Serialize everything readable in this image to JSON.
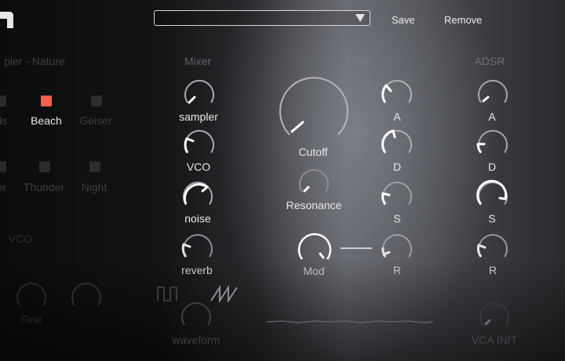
{
  "toolbar": {
    "preset_value": "",
    "save_label": "Save",
    "remove_label": "Remove"
  },
  "sampler": {
    "title": "pler - Nature",
    "pads": [
      "ds",
      "Beach",
      "Geiser",
      "er",
      "Thunder",
      "Night"
    ],
    "active_pad": "Beach",
    "active_color": "#f0604a"
  },
  "vco": {
    "title": "VCO",
    "knob_label": "Fine",
    "waveform_label": "waveform"
  },
  "mixer": {
    "title": "Mixer",
    "knobs": [
      "sampler",
      "VCO",
      "noise",
      "reverb"
    ]
  },
  "filter": {
    "title": "Filter",
    "cutoff_label": "Cutoff",
    "resonance_label": "Resonance",
    "mod_label": "Mod",
    "adsr": [
      "A",
      "D",
      "S",
      "R"
    ]
  },
  "adsr": {
    "title": "ADSR",
    "knobs": [
      "A",
      "D",
      "S",
      "R"
    ]
  },
  "vca": {
    "label": "VCA INIT"
  },
  "icons": {
    "logo": "logo-icon",
    "square_wave": "square-wave-icon",
    "saw_wave": "sawtooth-wave-icon"
  }
}
